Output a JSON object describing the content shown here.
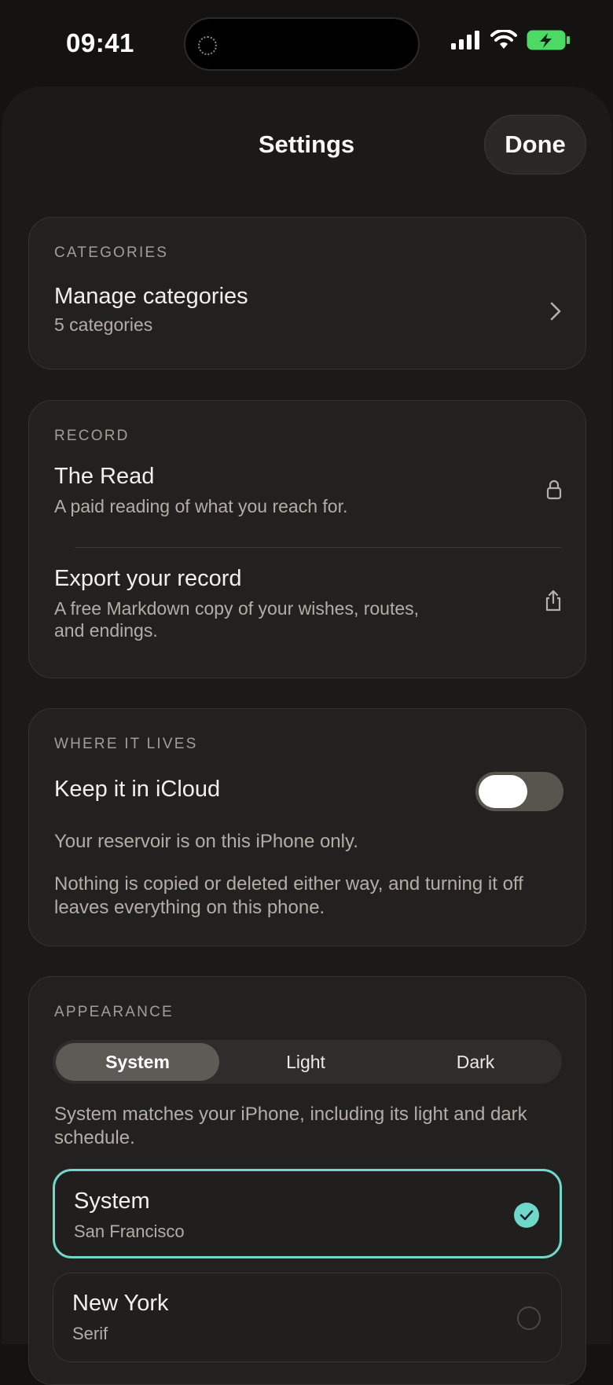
{
  "status_bar": {
    "time": "09:41"
  },
  "header": {
    "title": "Settings",
    "done_label": "Done"
  },
  "categories": {
    "section_label": "CATEGORIES",
    "manage_title": "Manage categories",
    "manage_subtitle": "5 categories"
  },
  "record": {
    "section_label": "RECORD",
    "items": [
      {
        "title": "The Read",
        "subtitle": "A paid reading of what you reach for.",
        "icon": "lock-icon"
      },
      {
        "title": "Export your record",
        "subtitle": "A free Markdown copy of your wishes, routes, and endings.",
        "icon": "share-icon"
      }
    ]
  },
  "where_it_lives": {
    "section_label": "WHERE IT LIVES",
    "icloud_label": "Keep it in iCloud",
    "icloud_enabled": false,
    "status_text": "Your reservoir is on this iPhone only.",
    "note_text": "Nothing is copied or deleted either way, and turning it off leaves everything on this phone."
  },
  "appearance": {
    "section_label": "APPEARANCE",
    "modes": [
      "System",
      "Light",
      "Dark"
    ],
    "selected_mode": "System",
    "mode_description": "System matches your iPhone, including its light and dark schedule.",
    "fonts": [
      {
        "title": "System",
        "subtitle": "San Francisco",
        "selected": true
      },
      {
        "title": "New York",
        "subtitle": "Serif",
        "selected": false
      }
    ]
  },
  "colors": {
    "accent": "#6fd8c8",
    "battery": "#4cd964",
    "background": "#141312",
    "card": "#23211f"
  }
}
